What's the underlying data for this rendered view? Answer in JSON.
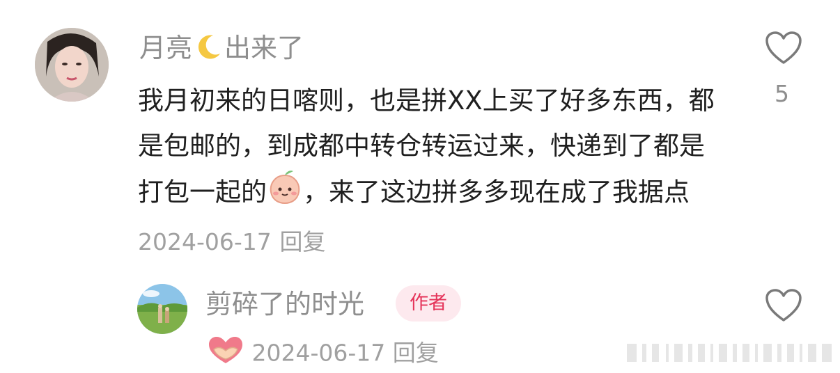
{
  "comment": {
    "author": {
      "name_part1": "月亮",
      "emoji": "crescent-moon",
      "name_part2": "出来了"
    },
    "text_part1": "我月初来的日喀则，也是拼XX上买了好多东西，都是包邮的，到成都中转仓转运过来，快递到了都是打包一起的",
    "emoji": "peach-face",
    "text_part2": "，来了这边拼多多现在成了我据点",
    "date": "2024-06-17",
    "reply_label": "回复",
    "like_count": "5"
  },
  "reply": {
    "author": {
      "name": "剪碎了的时光",
      "badge": "作者"
    },
    "emoji": "heart-hands",
    "date": "2024-06-17",
    "reply_label": "回复"
  },
  "colors": {
    "badge_bg": "#fde9ee",
    "badge_text": "#e5345a",
    "meta": "#a0a0a0",
    "name": "#8e8e8e"
  }
}
